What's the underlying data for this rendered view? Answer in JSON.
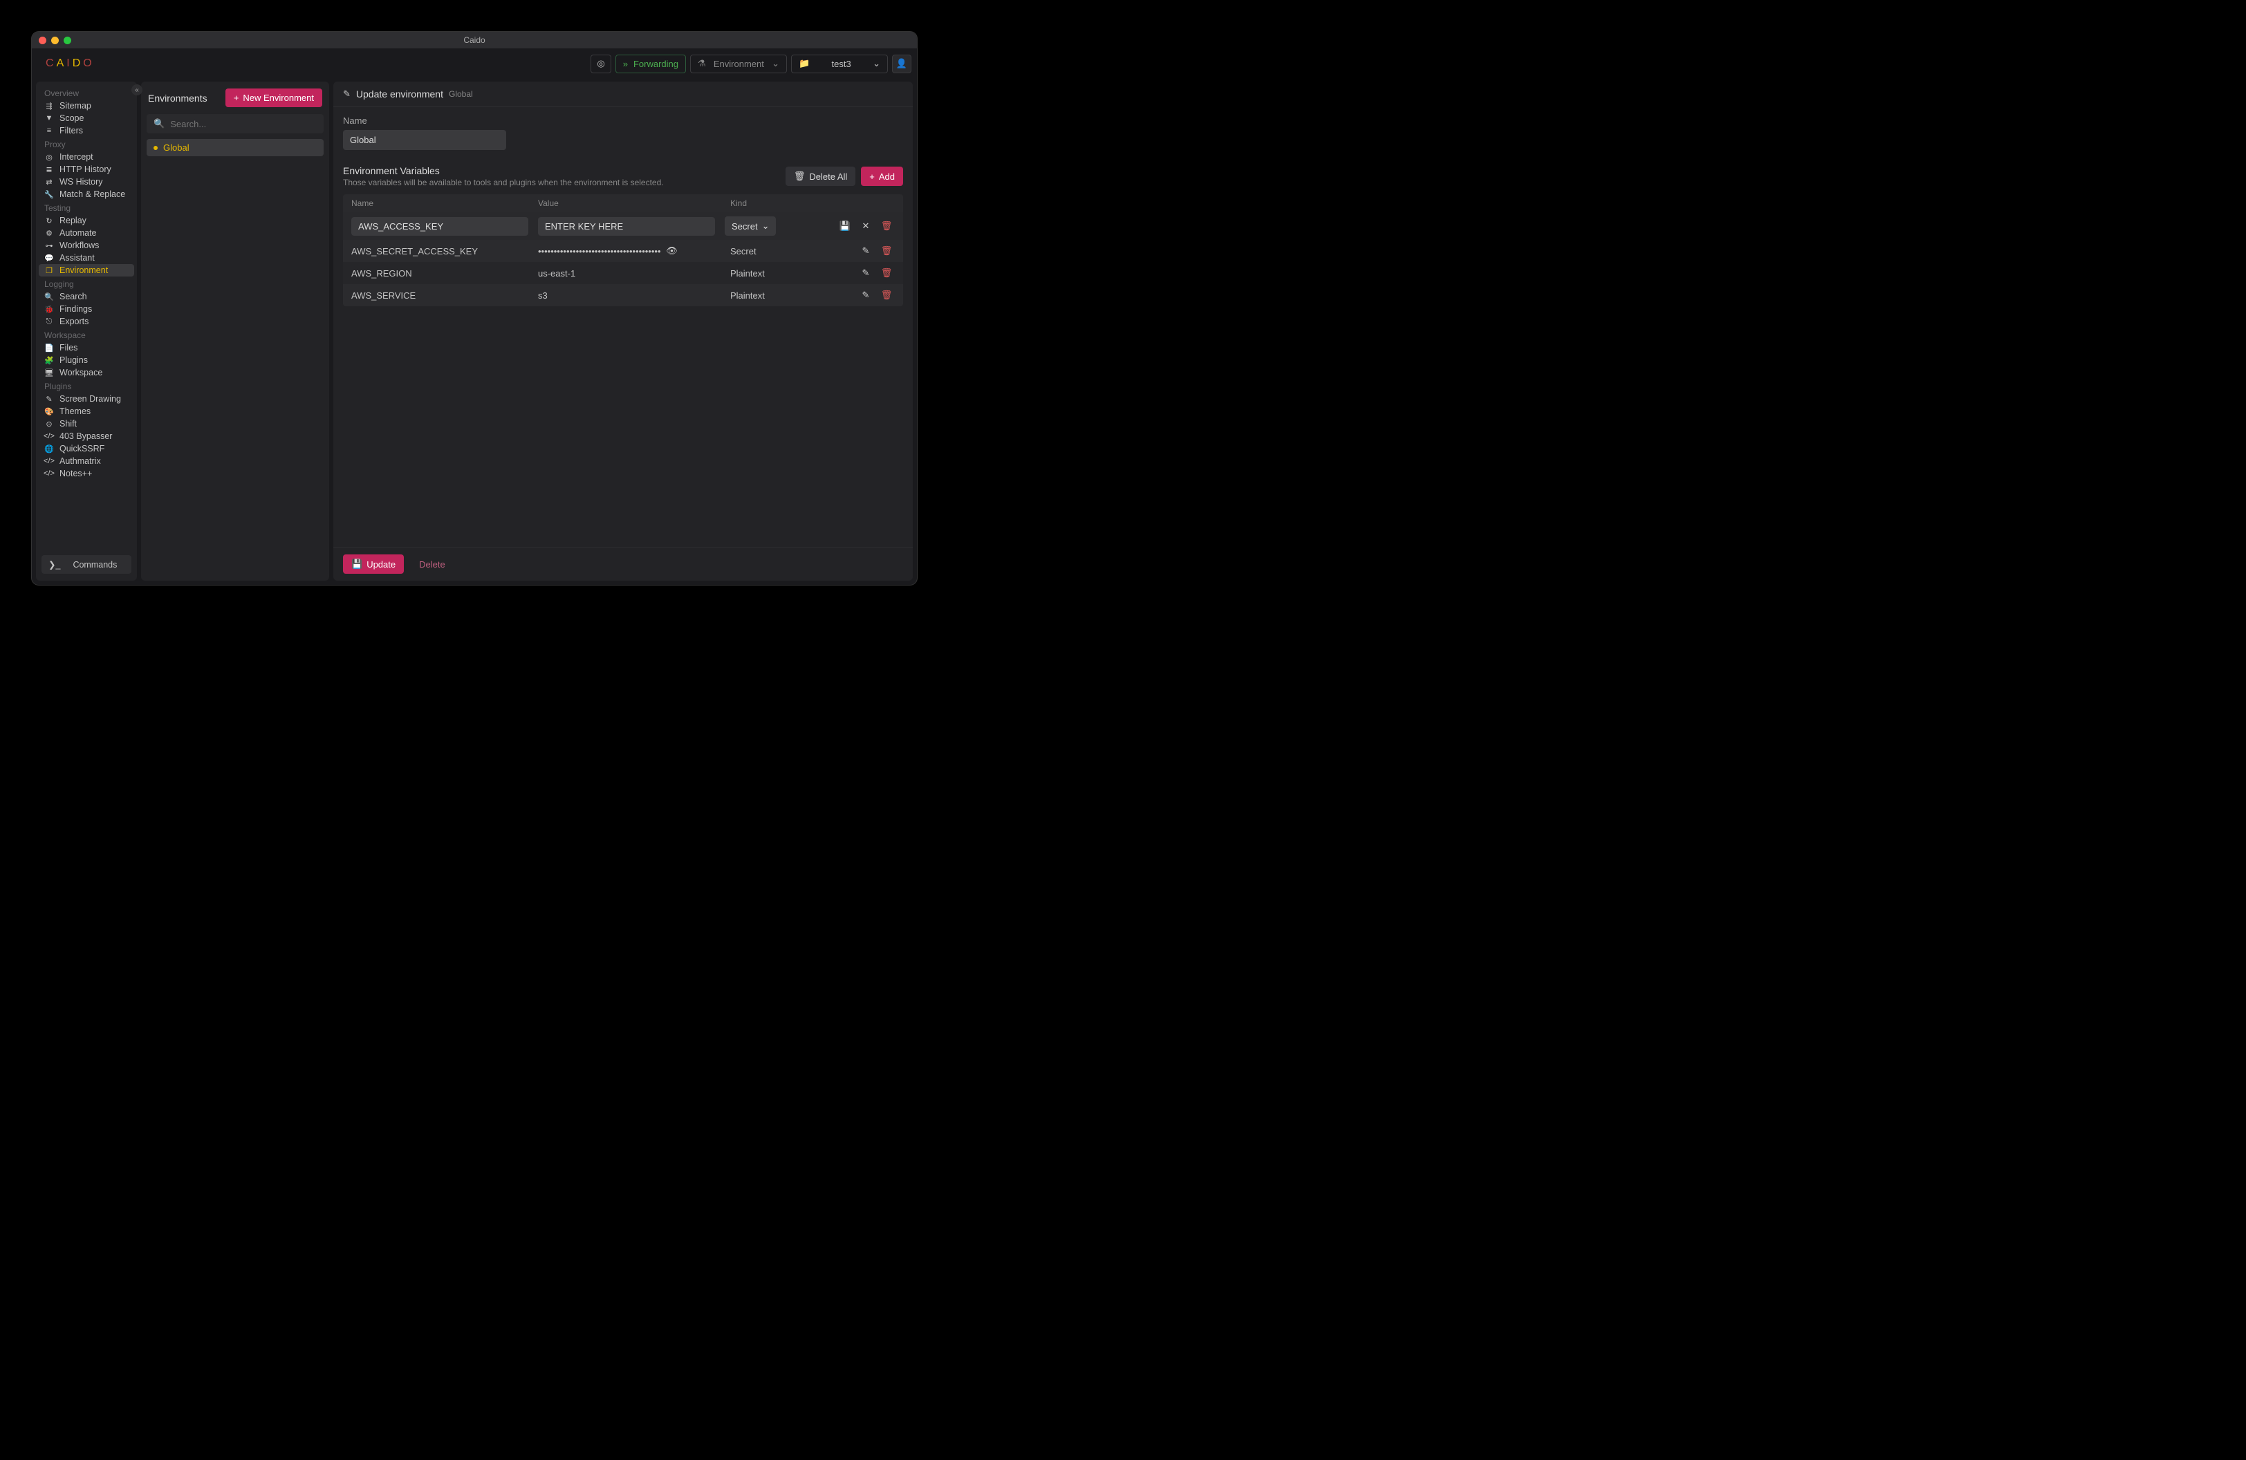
{
  "app": {
    "title": "Caido",
    "logo": "CAIDO"
  },
  "topbar": {
    "forwarding_label": "Forwarding",
    "env_dropdown_label": "Environment",
    "project_dropdown_label": "test3"
  },
  "sidebar": {
    "groups": [
      {
        "label": "Overview",
        "items": [
          {
            "label": "Sitemap",
            "icon": "sitemap"
          },
          {
            "label": "Scope",
            "icon": "filter"
          },
          {
            "label": "Filters",
            "icon": "sliders"
          }
        ]
      },
      {
        "label": "Proxy",
        "items": [
          {
            "label": "Intercept",
            "icon": "target"
          },
          {
            "label": "HTTP History",
            "icon": "list"
          },
          {
            "label": "WS History",
            "icon": "arrows"
          },
          {
            "label": "Match & Replace",
            "icon": "wrench"
          }
        ]
      },
      {
        "label": "Testing",
        "items": [
          {
            "label": "Replay",
            "icon": "refresh"
          },
          {
            "label": "Automate",
            "icon": "gear"
          },
          {
            "label": "Workflows",
            "icon": "tree"
          },
          {
            "label": "Assistant",
            "icon": "chat"
          },
          {
            "label": "Environment",
            "icon": "stack",
            "active": true
          }
        ]
      },
      {
        "label": "Logging",
        "items": [
          {
            "label": "Search",
            "icon": "search"
          },
          {
            "label": "Findings",
            "icon": "bug"
          },
          {
            "label": "Exports",
            "icon": "export"
          }
        ]
      },
      {
        "label": "Workspace",
        "items": [
          {
            "label": "Files",
            "icon": "file"
          },
          {
            "label": "Plugins",
            "icon": "puzzle"
          },
          {
            "label": "Workspace",
            "icon": "monitor"
          }
        ]
      },
      {
        "label": "Plugins",
        "items": [
          {
            "label": "Screen Drawing",
            "icon": "pen"
          },
          {
            "label": "Themes",
            "icon": "palette"
          },
          {
            "label": "Shift",
            "icon": "play"
          },
          {
            "label": "403 Bypasser",
            "icon": "code"
          },
          {
            "label": "QuickSSRF",
            "icon": "globe"
          },
          {
            "label": "Authmatrix",
            "icon": "code"
          },
          {
            "label": "Notes++",
            "icon": "code"
          }
        ]
      }
    ],
    "commands_label": "Commands"
  },
  "env_panel": {
    "title": "Environments",
    "new_btn": "New Environment",
    "search_placeholder": "Search...",
    "items": [
      {
        "name": "Global"
      }
    ]
  },
  "main": {
    "header_title": "Update environment",
    "header_sub": "Global",
    "name_label": "Name",
    "name_value": "Global",
    "vars_title": "Environment Variables",
    "vars_sub": "Those variables will be available to tools and plugins when the environment is selected.",
    "delete_all_label": "Delete All",
    "add_label": "Add",
    "table": {
      "col_name": "Name",
      "col_value": "Value",
      "col_kind": "Kind"
    },
    "editing_row": {
      "name": "AWS_ACCESS_KEY",
      "value": "ENTER KEY HERE",
      "kind": "Secret"
    },
    "rows": [
      {
        "name": "AWS_SECRET_ACCESS_KEY",
        "value": "•••••••••••••••••••••••••••••••••••••••",
        "kind": "Secret",
        "masked": true
      },
      {
        "name": "AWS_REGION",
        "value": "us-east-1",
        "kind": "Plaintext"
      },
      {
        "name": "AWS_SERVICE",
        "value": "s3",
        "kind": "Plaintext"
      }
    ],
    "update_label": "Update",
    "delete_label": "Delete"
  }
}
